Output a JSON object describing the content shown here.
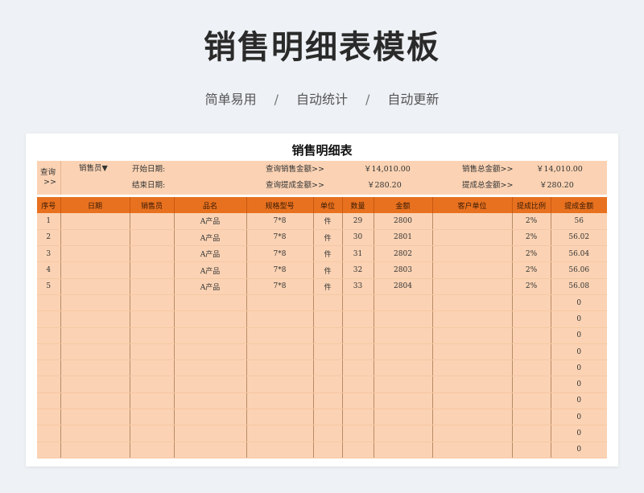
{
  "header": {
    "title": "销售明细表模板",
    "tags": [
      "简单易用",
      "自动统计",
      "自动更新"
    ],
    "separator": "/"
  },
  "sheet": {
    "title": "销售明细表",
    "query": {
      "line1": "查询",
      "line2": ">>"
    },
    "salesperson_label": "销售员▼",
    "start_date_label": "开始日期:",
    "end_date_label": "结束日期:",
    "query_sales_label": "查询销售金额>>",
    "query_sales_value": "￥14,010.00",
    "query_commission_label": "查询提成金额>>",
    "query_commission_value": "￥280.20",
    "total_sales_label": "销售总金额>>",
    "total_sales_value": "￥14,010.00",
    "total_commission_label": "提成总金额>>",
    "total_commission_value": "￥280.20",
    "columns": [
      "序号",
      "日期",
      "销售员",
      "品名",
      "规格型号",
      "单位",
      "数量",
      "金额",
      "客户单位",
      "提成比例",
      "提成金额"
    ],
    "rows": [
      [
        "1",
        "",
        "",
        "A产品",
        "7*8",
        "件",
        "29",
        "2800",
        "",
        "2%",
        "56"
      ],
      [
        "2",
        "",
        "",
        "A产品",
        "7*8",
        "件",
        "30",
        "2801",
        "",
        "2%",
        "56.02"
      ],
      [
        "3",
        "",
        "",
        "A产品",
        "7*8",
        "件",
        "31",
        "2802",
        "",
        "2%",
        "56.04"
      ],
      [
        "4",
        "",
        "",
        "A产品",
        "7*8",
        "件",
        "32",
        "2803",
        "",
        "2%",
        "56.06"
      ],
      [
        "5",
        "",
        "",
        "A产品",
        "7*8",
        "件",
        "33",
        "2804",
        "",
        "2%",
        "56.08"
      ],
      [
        "",
        "",
        "",
        "",
        "",
        "",
        "",
        "",
        "",
        "",
        "0"
      ],
      [
        "",
        "",
        "",
        "",
        "",
        "",
        "",
        "",
        "",
        "",
        "0"
      ],
      [
        "",
        "",
        "",
        "",
        "",
        "",
        "",
        "",
        "",
        "",
        "0"
      ],
      [
        "",
        "",
        "",
        "",
        "",
        "",
        "",
        "",
        "",
        "",
        "0"
      ],
      [
        "",
        "",
        "",
        "",
        "",
        "",
        "",
        "",
        "",
        "",
        "0"
      ],
      [
        "",
        "",
        "",
        "",
        "",
        "",
        "",
        "",
        "",
        "",
        "0"
      ],
      [
        "",
        "",
        "",
        "",
        "",
        "",
        "",
        "",
        "",
        "",
        "0"
      ],
      [
        "",
        "",
        "",
        "",
        "",
        "",
        "",
        "",
        "",
        "",
        "0"
      ],
      [
        "",
        "",
        "",
        "",
        "",
        "",
        "",
        "",
        "",
        "",
        "0"
      ],
      [
        "",
        "",
        "",
        "",
        "",
        "",
        "",
        "",
        "",
        "",
        "0"
      ]
    ]
  }
}
